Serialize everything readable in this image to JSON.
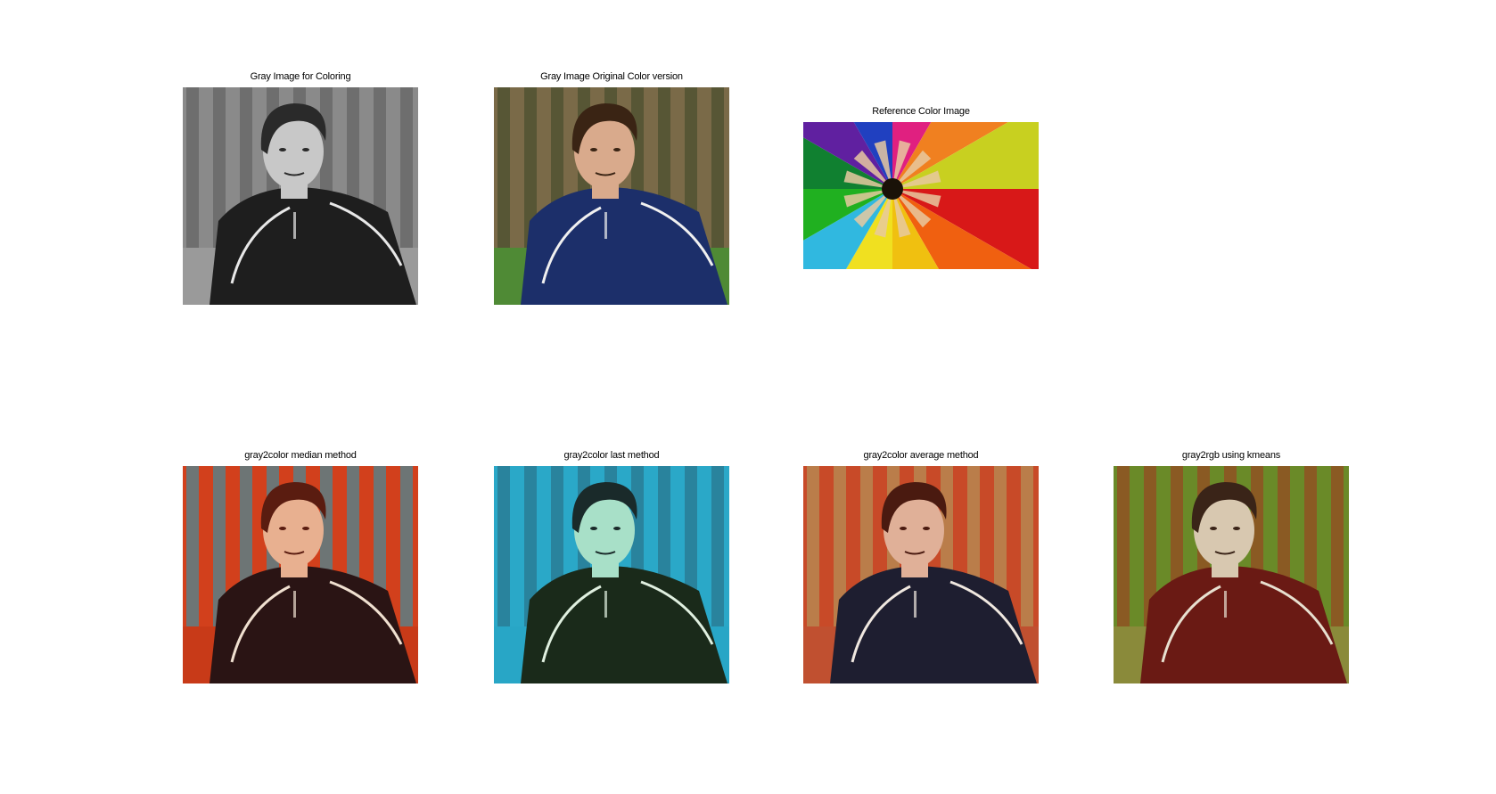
{
  "panels": [
    {
      "title": "Gray Image for Coloring",
      "variant": "gray"
    },
    {
      "title": "Gray Image Original Color version",
      "variant": "original"
    },
    {
      "title": "Reference Color Image",
      "variant": "reference"
    },
    {
      "title": "gray2color median method",
      "variant": "median"
    },
    {
      "title": "gray2color last method",
      "variant": "last"
    },
    {
      "title": "gray2color average method",
      "variant": "average"
    },
    {
      "title": "gray2rgb using kmeans",
      "variant": "kmeans"
    }
  ],
  "palette": {
    "gray": {
      "bg1": "#8a8a8a",
      "bg2": "#5c5c5c",
      "ground": "#9a9a9a",
      "skin": "#c8c8c8",
      "hair": "#2a2a2a",
      "jacket": "#1e1e1e",
      "stripe": "#e8e8e8"
    },
    "original": {
      "bg1": "#7a6a48",
      "bg2": "#3f4a2a",
      "ground": "#4f8a35",
      "skin": "#d9aa8c",
      "hair": "#3a2414",
      "jacket": "#1c2f6a",
      "stripe": "#f0f0f0"
    },
    "median": {
      "bg1": "#d2401c",
      "bg2": "#2a9ab0",
      "ground": "#c83a18",
      "skin": "#e8b090",
      "hair": "#5a1c10",
      "jacket": "#2a1414",
      "stripe": "#f0e0d0"
    },
    "last": {
      "bg1": "#2aa8c8",
      "bg2": "#2a6a80",
      "ground": "#28a6c6",
      "skin": "#a8e0c8",
      "hair": "#1a2a2a",
      "jacket": "#1a2a1a",
      "stripe": "#e0f0e0"
    },
    "average": {
      "bg1": "#c84a28",
      "bg2": "#b0a060",
      "ground": "#c05030",
      "skin": "#e0b098",
      "hair": "#4a1a10",
      "jacket": "#1e1e30",
      "stripe": "#f0e8e0"
    },
    "kmeans": {
      "bg1": "#6a8a28",
      "bg2": "#a03a20",
      "ground": "#8a8a3a",
      "skin": "#d8c8b0",
      "hair": "#3a2418",
      "jacket": "#6a1a14",
      "stripe": "#e8e0d0"
    }
  },
  "reference_colors": [
    "#d81818",
    "#f06010",
    "#f0c010",
    "#f0e020",
    "#30b8e0",
    "#20b020",
    "#108030",
    "#6020a0",
    "#2040c0",
    "#e02080",
    "#f08020",
    "#c8d020"
  ]
}
